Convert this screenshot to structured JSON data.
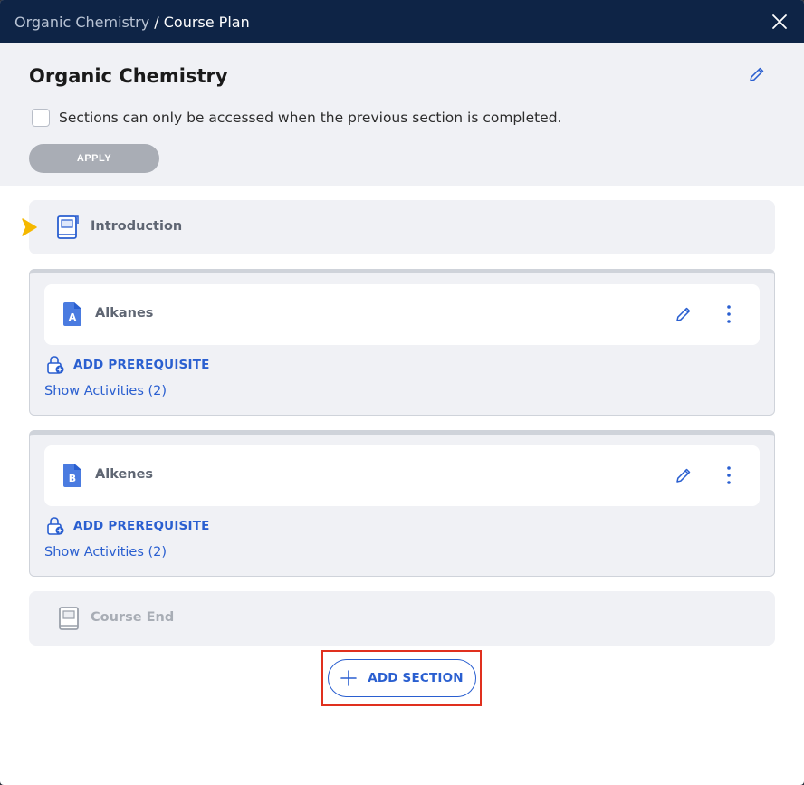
{
  "titlebar": {
    "breadcrumb_parent": "Organic Chemistry",
    "breadcrumb_sep": " / ",
    "breadcrumb_current": "Course Plan",
    "close_icon": "close-icon"
  },
  "header": {
    "course_title": "Organic Chemistry",
    "edit_icon": "pencil-icon",
    "checkbox_label": "Sections can only be accessed when the previous section is completed.",
    "checkbox_checked": false,
    "apply_label": "APPLY"
  },
  "intro": {
    "label": "Introduction",
    "icon": "book-icon",
    "marker_icon": "current-position-arrow-icon"
  },
  "sections": [
    {
      "letter": "A",
      "label": "Alkanes",
      "add_prereq_label": "ADD PREREQUISITE",
      "show_activities_label": "Show Activities (2)"
    },
    {
      "letter": "B",
      "label": "Alkenes",
      "add_prereq_label": "ADD PREREQUISITE",
      "show_activities_label": "Show Activities (2)"
    }
  ],
  "course_end": {
    "label": "Course End",
    "icon": "book-icon"
  },
  "add_section_label": "ADD SECTION",
  "colors": {
    "titlebar_bg": "#0e2446",
    "accent_blue": "#2a5fd0",
    "marker_yellow": "#f5b800",
    "highlight_red": "#e0301e"
  }
}
